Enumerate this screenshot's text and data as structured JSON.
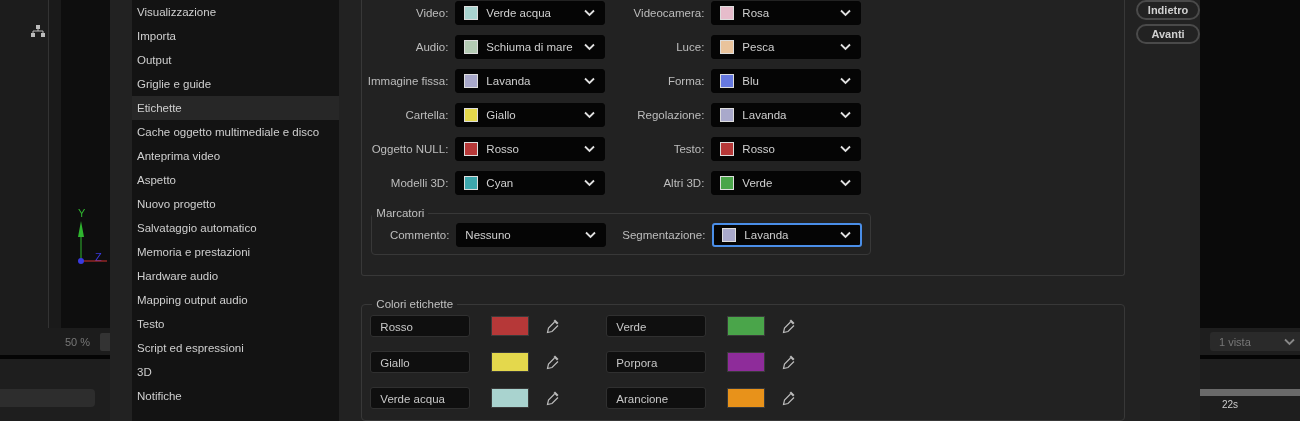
{
  "left_panel": {
    "axis_labels": [
      "Y",
      "Z"
    ],
    "zoom": "50 %"
  },
  "categories": [
    {
      "label": "Visualizzazione",
      "selected": false
    },
    {
      "label": "Importa",
      "selected": false
    },
    {
      "label": "Output",
      "selected": false
    },
    {
      "label": "Griglie e guide",
      "selected": false
    },
    {
      "label": "Etichette",
      "selected": true
    },
    {
      "label": "Cache oggetto multimediale e disco",
      "selected": false
    },
    {
      "label": "Anteprima video",
      "selected": false
    },
    {
      "label": "Aspetto",
      "selected": false
    },
    {
      "label": "Nuovo progetto",
      "selected": false
    },
    {
      "label": "Salvataggio automatico",
      "selected": false
    },
    {
      "label": "Memoria e prestazioni",
      "selected": false
    },
    {
      "label": "Hardware audio",
      "selected": false
    },
    {
      "label": "Mapping output audio",
      "selected": false
    },
    {
      "label": "Testo",
      "selected": false
    },
    {
      "label": "Script ed espressioni",
      "selected": false
    },
    {
      "label": "3D",
      "selected": false
    },
    {
      "label": "Notifiche",
      "selected": false
    }
  ],
  "label_defaults": [
    {
      "label": "Video:",
      "value": "Verde acqua",
      "color": "#a9d3cf",
      "focused": false
    },
    {
      "label": "Videocamera:",
      "value": "Rosa",
      "color": "#e6bccb",
      "focused": false
    },
    {
      "label": "Audio:",
      "value": "Schiuma di mare",
      "color": "#b4cbb4",
      "focused": false
    },
    {
      "label": "Luce:",
      "value": "Pesca",
      "color": "#e9c39c",
      "focused": false
    },
    {
      "label": "Immagine fissa:",
      "value": "Lavanda",
      "color": "#a9a9cb",
      "focused": false
    },
    {
      "label": "Forma:",
      "value": "Blu",
      "color": "#6679e0",
      "focused": false
    },
    {
      "label": "Cartella:",
      "value": "Giallo",
      "color": "#e4d84c",
      "focused": false
    },
    {
      "label": "Regolazione:",
      "value": "Lavanda",
      "color": "#a9a9cb",
      "focused": false
    },
    {
      "label": "Oggetto NULL:",
      "value": "Rosso",
      "color": "#b63838",
      "focused": false
    },
    {
      "label": "Testo:",
      "value": "Rosso",
      "color": "#b63838",
      "focused": false
    },
    {
      "label": "Modelli 3D:",
      "value": "Cyan",
      "color": "#3ea7ad",
      "focused": false
    },
    {
      "label": "Altri 3D:",
      "value": "Verde",
      "color": "#4aa54a",
      "focused": false
    }
  ],
  "markers": {
    "title": "Marcatori",
    "items": [
      {
        "label": "Commento:",
        "value": "Nessuno",
        "focused": false
      },
      {
        "label": "Segmentazione:",
        "value": "Lavanda",
        "color": "#a9a9cb",
        "focused": true
      }
    ]
  },
  "label_colors": {
    "title": "Colori etichette",
    "items": [
      {
        "name": "Rosso",
        "color": "#b63838"
      },
      {
        "name": "Verde",
        "color": "#4aa54a"
      },
      {
        "name": "Giallo",
        "color": "#e4d84c"
      },
      {
        "name": "Porpora",
        "color": "#8e2c9a"
      },
      {
        "name": "Verde acqua",
        "color": "#a9d3cf"
      },
      {
        "name": "Arancione",
        "color": "#e8921a"
      }
    ]
  },
  "buttons": [
    {
      "label": "Indietro"
    },
    {
      "label": "Avanti"
    }
  ],
  "right_panel": {
    "view": "1 vista",
    "time": "22s"
  }
}
